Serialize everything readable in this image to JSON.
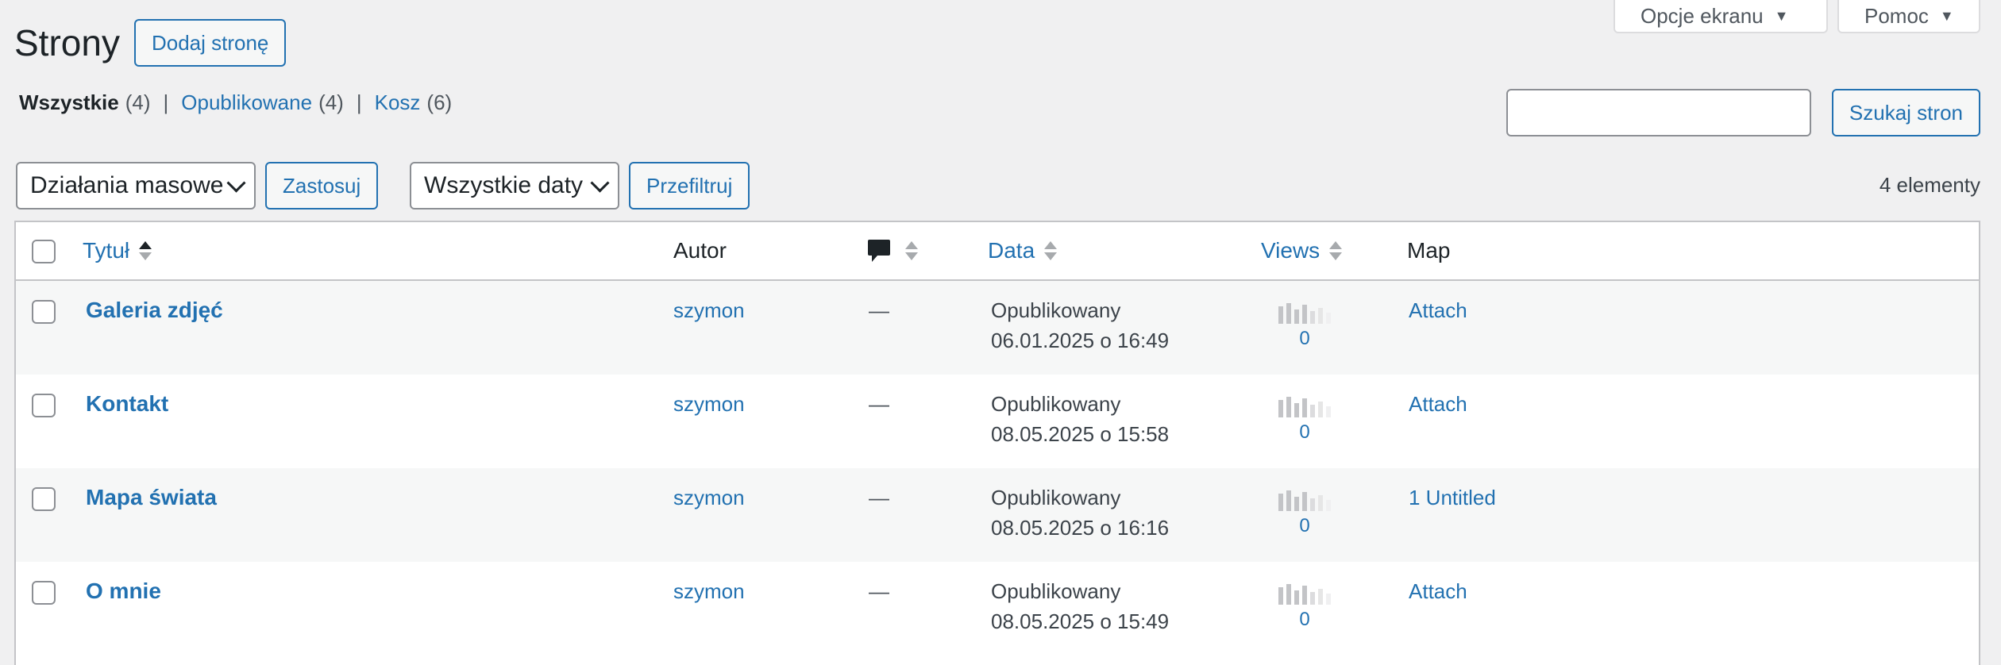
{
  "screen_meta": {
    "screen_options": "Opcje ekranu",
    "help": "Pomoc"
  },
  "header": {
    "title": "Strony",
    "add_new": "Dodaj stronę"
  },
  "filters": {
    "all": {
      "label": "Wszystkie",
      "count": "(4)"
    },
    "published": {
      "label": "Opublikowane",
      "count": "(4)"
    },
    "trash": {
      "label": "Kosz",
      "count": "(6)"
    },
    "separator": "|"
  },
  "search": {
    "value": "",
    "button": "Szukaj stron"
  },
  "tablenav": {
    "bulk_actions": "Działania masowe",
    "apply": "Zastosuj",
    "all_dates": "Wszystkie daty",
    "filter": "Przefiltruj",
    "items_count": "4 elementy"
  },
  "columns": {
    "title": "Tytuł",
    "author": "Autor",
    "date": "Data",
    "views": "Views",
    "map": "Map"
  },
  "icons": {
    "comments": "comment-bubble-icon",
    "sort": "sort-arrows-icon",
    "dropdown": "chevron-down-icon",
    "caret": "triangle-down-icon"
  },
  "colors": {
    "link": "#2271b1",
    "background": "#f0f0f1",
    "row_alt": "#f6f7f7",
    "border": "#c3c4c7"
  },
  "rows": [
    {
      "title": "Galeria zdjęć",
      "author": "szymon",
      "comments": "—",
      "status": "Opublikowany",
      "date": "06.01.2025 o 16:49",
      "views": "0",
      "map": "Attach"
    },
    {
      "title": "Kontakt",
      "author": "szymon",
      "comments": "—",
      "status": "Opublikowany",
      "date": "08.05.2025 o 15:58",
      "views": "0",
      "map": "Attach"
    },
    {
      "title": "Mapa świata",
      "author": "szymon",
      "comments": "—",
      "status": "Opublikowany",
      "date": "08.05.2025 o 16:16",
      "views": "0",
      "map": "1 Untitled"
    },
    {
      "title": "O mnie",
      "author": "szymon",
      "comments": "—",
      "status": "Opublikowany",
      "date": "08.05.2025 o 15:49",
      "views": "0",
      "map": "Attach"
    }
  ]
}
